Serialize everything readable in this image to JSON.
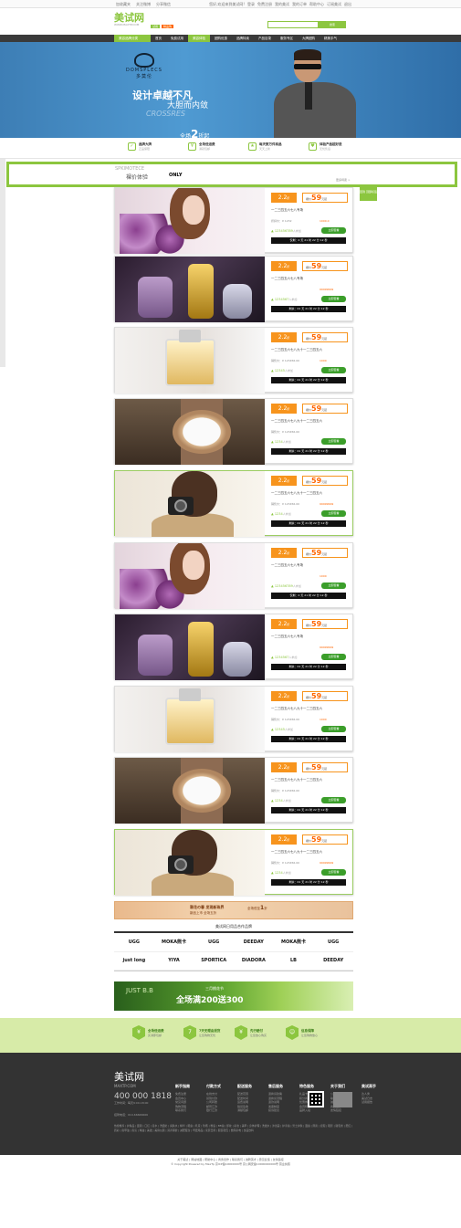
{
  "topbar": {
    "left": [
      "加收藏夹",
      "关注微博",
      "分享微信"
    ],
    "right": [
      "您好,欢迎来到美试网!",
      "登录",
      "免费注册",
      "我的美试",
      "我的订单",
      "帮助中心",
      "订阅美试",
      "退出"
    ]
  },
  "header": {
    "logo_cn": "美试网",
    "logo_en": "WWW.MAXTP.COM",
    "badge1": "试用",
    "badge2": "精品购",
    "search_placeholder": "",
    "search_btn": "搜索"
  },
  "nav": {
    "items": [
      "美容品牌分类",
      "首页",
      "免费试用",
      "美容体验",
      "团购优惠",
      "品牌特卖",
      "产品目录",
      "服务专区",
      "大牌团购",
      "精美手气"
    ]
  },
  "banner": {
    "brand": "DOMSPLECS",
    "brand_cn": "多莫伦",
    "line1": "设计卓越不凡",
    "line2": "大胆而内敛",
    "line3": "CROSSRES",
    "sale": "全场",
    "sale_num": "2",
    "sale_tail": "折起"
  },
  "features": [
    {
      "icon": "✓",
      "title": "品牌大牌",
      "sub": "正品保障"
    },
    {
      "icon": "¥",
      "title": "全场低运费",
      "sub": "满就包邮"
    },
    {
      "icon": "★",
      "title": "每天数万件商品",
      "sub": "天天上新"
    },
    {
      "icon": "♥",
      "title": "体验产品超好退",
      "sub": "无忧售后"
    }
  ],
  "brandstrip": {
    "a": "SPKIMOTECE",
    "b": "裸价体验",
    "c": "ONLY",
    "d": "更多特卖 >"
  },
  "sidetag": "回到\n顶部标签",
  "deals": [
    {
      "art": "woman",
      "disc": "2.2",
      "price": "59",
      "title": "一二三四五六七八专场",
      "orig": "折扣价：¥ 1232",
      "pct": "1000.0",
      "sold": "123456789",
      "btn": "立即查看",
      "cd": "仅剩：0 天 21 时 22 分 12 秒"
    },
    {
      "art": "perf",
      "disc": "2.2",
      "price": "59",
      "title": "一二三四五六七八专场",
      "orig": "",
      "pct": "99999999",
      "sold": "1234567",
      "btn": "立即查看",
      "cd": "剩余：01 天 21 时 22 分 12 秒"
    },
    {
      "art": "perf2",
      "disc": "2.2",
      "price": "59",
      "title": "一二三四五六七八九十一二三四五六",
      "orig": "销售价：¥ 123456.00",
      "pct": "1000",
      "sold": "12345",
      "btn": "立即查看",
      "cd": "剩余：01 天 21 时 22 分 12 秒"
    },
    {
      "art": "watch",
      "disc": "2.2",
      "price": "59",
      "title": "一二三四五六七八九十一二三四五六",
      "orig": "销售价：¥ 123456.00",
      "pct": "",
      "sold": "1234",
      "btn": "立即查看",
      "cd": "剩余：01 天 21 时 22 分 12 秒"
    },
    {
      "art": "girl",
      "disc": "2.2",
      "price": "59",
      "title": "一二三四五六七八九十一二三四五六",
      "orig": "销售价：¥ 123456.00",
      "pct": "99999999",
      "sold": "1234",
      "btn": "立即查看",
      "cd": "剩余：01 天 21 时 22 分 12 秒"
    },
    {
      "art": "woman",
      "disc": "2.2",
      "price": "59",
      "title": "一二三四五六七八专场",
      "orig": "",
      "pct": "1000",
      "sold": "123456789",
      "btn": "立即查看",
      "cd": "仅剩：0 天 21 时 22 分 12 秒"
    },
    {
      "art": "perf",
      "disc": "2.2",
      "price": "59",
      "title": "一二三四五六七八专场",
      "orig": "",
      "pct": "99999999",
      "sold": "1234567",
      "btn": "立即查看",
      "cd": "剩余：01 天 21 时 22 分 12 秒"
    },
    {
      "art": "perf2",
      "disc": "2.2",
      "price": "59",
      "title": "一二三四五六七八九十一二三四五六",
      "orig": "销售价：¥ 123456.00",
      "pct": "1000",
      "sold": "12345",
      "btn": "立即查看",
      "cd": "剩余：01 天 21 时 22 分 12 秒"
    },
    {
      "art": "watch",
      "disc": "2.2",
      "price": "59",
      "title": "一二三四五六七八九十一二三四五六",
      "orig": "销售价：¥ 123456.00",
      "pct": "",
      "sold": "1234",
      "btn": "立即查看",
      "cd": "剩余：01 天 21 时 22 分 12 秒"
    },
    {
      "art": "girl",
      "disc": "2.2",
      "price": "59",
      "title": "一二三四五六七八九十一二三四五六",
      "orig": "销售价：¥ 123456.00",
      "pct": "99999999",
      "sold": "1234",
      "btn": "立即查看",
      "cd": "剩余：01 天 21 时 22 分 12 秒"
    }
  ],
  "deal_labels": {
    "price_pre": "裸价",
    "price_unit": "元起",
    "disc_unit": "折",
    "sold_unit": "人参加"
  },
  "promo": {
    "l1": "翠花の春 发现新珠界",
    "l2": "新品上市 全场五折",
    "r1": "全场低至",
    "r2": "1",
    "r3": "折"
  },
  "brands": {
    "title": "美试网日用品合作品牌",
    "items": [
      "UGG",
      "MOKA熊卡",
      "UGG",
      "DEEDAY",
      "MOKA熊卡",
      "UGG",
      "just long",
      "YIYA",
      "SPORTICA",
      "DIADORA",
      "LB",
      "DEEDAY"
    ]
  },
  "greenban": {
    "a": "JUST B.B",
    "b": "三月桃花节",
    "c": "全场满200送300"
  },
  "service": [
    {
      "icon": "¥",
      "title": "全场低运费",
      "sub": "买满即包邮"
    },
    {
      "icon": "7",
      "title": "7天无理由退货",
      "sub": "让您购物无忧"
    },
    {
      "icon": "¥",
      "title": "先行赔付",
      "sub": "让您放心购买"
    },
    {
      "icon": "☺",
      "title": "信息保障",
      "sub": "让您购物放心"
    }
  ],
  "footer": {
    "logo": "美试网",
    "logo_en": "MAXTP.COM",
    "tel": "400 000 1818",
    "hours": "工作时间：每天9:00-18:00",
    "fax": "招聘电话：010-66666666",
    "cols": [
      {
        "title": "新手指南",
        "items": [
          "免费注册",
          "会员中心",
          "常见问题",
          "购物流程",
          "联系我们"
        ]
      },
      {
        "title": "付款方式",
        "items": [
          "在线支付",
          "货到付款",
          "公司转账",
          "邮局汇款",
          "银行汇款"
        ]
      },
      {
        "title": "配送服务",
        "items": [
          "配送范围",
          "配送时间",
          "运费说明",
          "验货签收",
          "满额包邮"
        ]
      },
      {
        "title": "售后服务",
        "items": [
          "退换货政策",
          "退换货流程",
          "退款说明",
          "发票制度",
          "投诉建议"
        ]
      },
      {
        "title": "特色服务",
        "items": [
          "礼品卡",
          "积分商城",
          "优惠券",
          "会员特权",
          "品牌入驻"
        ]
      },
      {
        "title": "关于我们",
        "items": [
          "公司简介",
          "联系我们",
          "诚聘英才",
          "商务合作",
          "友情链接"
        ]
      },
      {
        "title": "美试高手",
        "items": [
          "达人秀",
          "美试日志",
          "试用报告"
        ]
      }
    ],
    "links": "热搜推荐 | 护肤品 | 面膜 | 口红 | 香水 | 洗面奶 | 爽肤水 | 精华 | 眼霜 | 乳液 | 防晒 | 粉底 | BB霜 | 卸妆 | 彩妆 | 美甲 | 身体护理 | 洗发水 | 沐浴露 | 护手霜 | 男士护肤 | 面霜 | 隔离 | 遮瑕 | 眼影 | 睫毛膏 | 腮红 | 唇彩 | 指甲油 | 香氛 | 精油 | 美发 | 美容仪器 | 营养保健 | 减肥瘦身 | 母婴用品 | 家居日用 | 服装鞋包 | 数码家电 | 食品饮料"
  },
  "copy": {
    "l1": "关于美试 | 网站地图 | 帮助中心 | 商务合作 | 联系我们 | 诚聘英才 | 意见反馈 | 友情链接",
    "l2": "© Copyright Powered by MaxTp 京ICP备10000000号 京公网安备10000000000号 营业执照"
  }
}
